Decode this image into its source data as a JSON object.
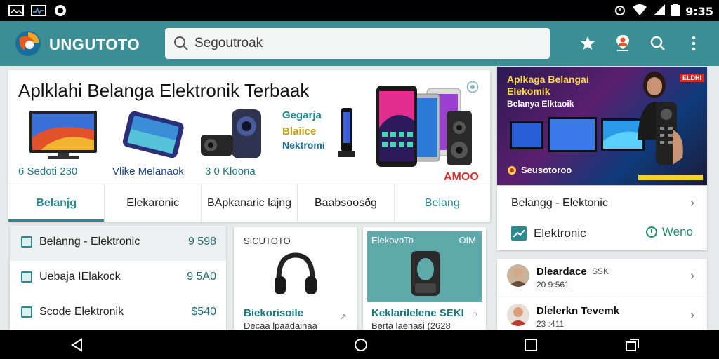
{
  "status_bar": {
    "time": "9:35"
  },
  "app_bar": {
    "brand": "UNGUTOTO",
    "search_placeholder": "Segoutroak"
  },
  "hero": {
    "title": "Aplklahi Belanga Elektronik Terbaak",
    "items": [
      {
        "caption": "6 Sedoti 230"
      },
      {
        "caption": "Vlike Melanaok"
      },
      {
        "caption": "3 0 Kloona"
      }
    ],
    "poster_text": [
      "Gegarja",
      "Blaiice",
      "Nektromi"
    ],
    "brand_badge": "AMOO"
  },
  "tabs": [
    {
      "label": "Belanjg",
      "active": true
    },
    {
      "label": "Elekaronic",
      "active": false
    },
    {
      "label": "BApkanaric lajng",
      "active": false
    },
    {
      "label": "Baabsoosðg",
      "active": false
    },
    {
      "label": "Belang",
      "active": false
    }
  ],
  "promo": {
    "line1": "Aplkaga Belangai",
    "line2": "Elekomik",
    "line3": "Belanya Elktaoik",
    "cta": "Seusotoroo",
    "badge": "ELDHI"
  },
  "promo_info": {
    "title": "Belangg - Elektonic",
    "category": "Elektronic",
    "link": "Weno"
  },
  "category_list": [
    {
      "label": "Belanng - Elektronic",
      "value": "9 598"
    },
    {
      "label": "Uebaja IElakock",
      "value": "9 5A0"
    },
    {
      "label": "Scode Elektronik",
      "value": "$540"
    }
  ],
  "products": [
    {
      "tag": "SICUTOTO",
      "name": "Biekorisoile",
      "sub": "Decaa lpaadainaa"
    },
    {
      "tag": "ElekovoTo",
      "price_tag": "OIM",
      "name": "Keklarilelene SEKI",
      "sub": "Berta laenasi (2628"
    }
  ],
  "feed": [
    {
      "name": "Dleardace",
      "extra": "SSK",
      "time": "20 9:561"
    },
    {
      "name": "Dlelerkn Tevemk",
      "time": "23 :411"
    }
  ],
  "colors": {
    "accent": "#3b8e94",
    "teal_text": "#2a8a8f",
    "link_green": "#1c8f6d"
  }
}
